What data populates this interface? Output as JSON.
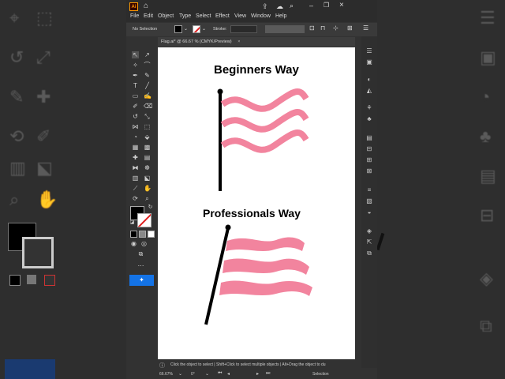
{
  "menubar": {
    "app_logo": "Ai",
    "items": [
      "File",
      "Edit",
      "Object",
      "Type",
      "Select",
      "Effect",
      "View",
      "Window",
      "Help"
    ]
  },
  "control_bar": {
    "selection_label": "No Selection",
    "stroke_label": "Stroke:"
  },
  "document": {
    "tab_title": "Flag.ai* @ 66.67 % (CMYK/Preview)"
  },
  "canvas": {
    "heading_top": "Beginners Way",
    "heading_bottom": "Professionals Way",
    "flag_color": "#f2849e",
    "pole_color": "#000000"
  },
  "status": {
    "hint_text": "Click the object to select  |  Shift+Click to select multiple objects  |  Alt+Drag the object to du",
    "zoom": "66.67%",
    "rotation": "0°",
    "tool_name": "Selection"
  },
  "colors": {
    "accent": "#1473e6",
    "fill_swatch": "#000000",
    "panel_bg": "#323232"
  }
}
